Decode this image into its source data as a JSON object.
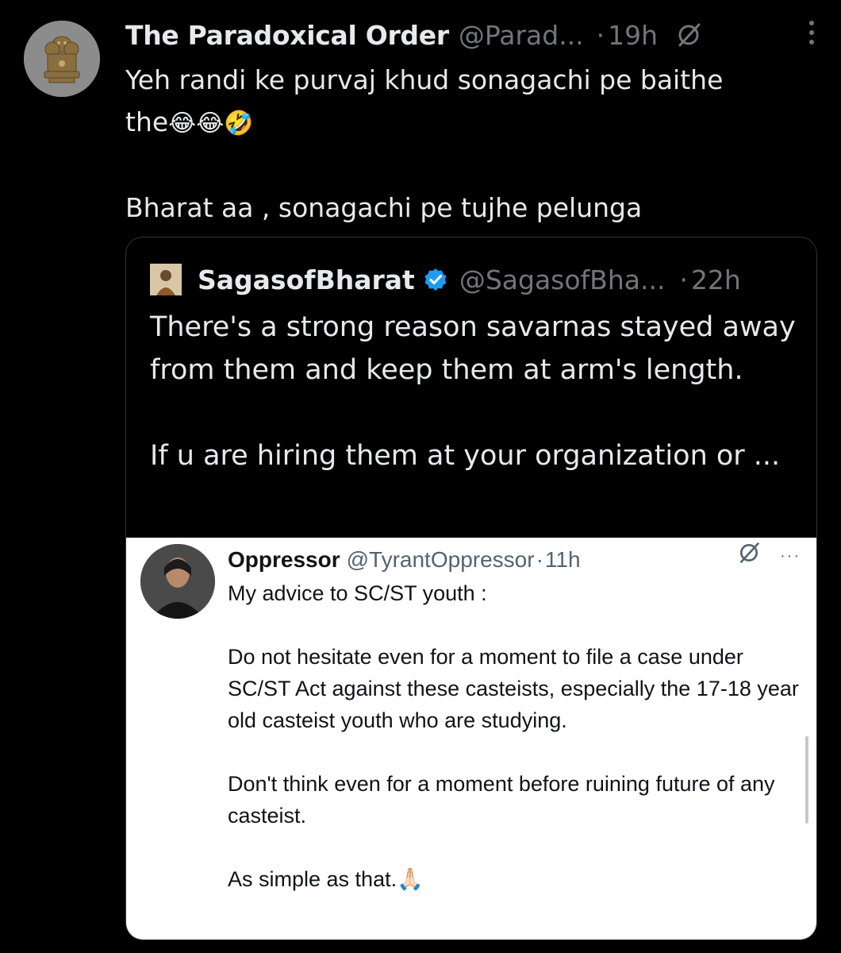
{
  "tweet": {
    "author_name": "The Paradoxical Order",
    "handle": "@Parad...",
    "separator": "·",
    "time": "19h",
    "text_line1": "Yeh randi ke purvaj khud sonagachi pe baithe",
    "text_line2": "the",
    "emojis": "😂😂🤣",
    "text_line3": "Bharat aa , sonagachi pe tujhe pelunga",
    "icons": {
      "grok": "grok-slash-icon",
      "more": "more-vertical-icon",
      "avatar": "national-emblem-avatar"
    }
  },
  "quote": {
    "author_name": "SagasofBharat",
    "handle": "@SagasofBha...",
    "separator": "·",
    "time": "22h",
    "paragraph1": "There's a strong reason savarnas stayed away from them and keep them at arm's length.",
    "paragraph2": "If u are hiring them at your organization or ...",
    "verified_color": "#1d9bf0"
  },
  "embedded": {
    "author_name": "Oppressor",
    "handle": "@TyrantOppressor",
    "time_sep": "·",
    "time": "11h",
    "more": "···",
    "line1": "My advice to SC/ST youth :",
    "para2": "Do not hesitate even for a moment to file a case under SC/ST Act against these casteists, especially the 17-18 year old casteist youth who are studying.",
    "para3": "Don't think even for a moment before ruining future of any casteist.",
    "para4": "As simple as that.",
    "emoji": "🙏🏻"
  },
  "colors": {
    "background": "#000000",
    "text": "#e7e9ea",
    "muted": "#71767b",
    "border": "#2f3336"
  }
}
